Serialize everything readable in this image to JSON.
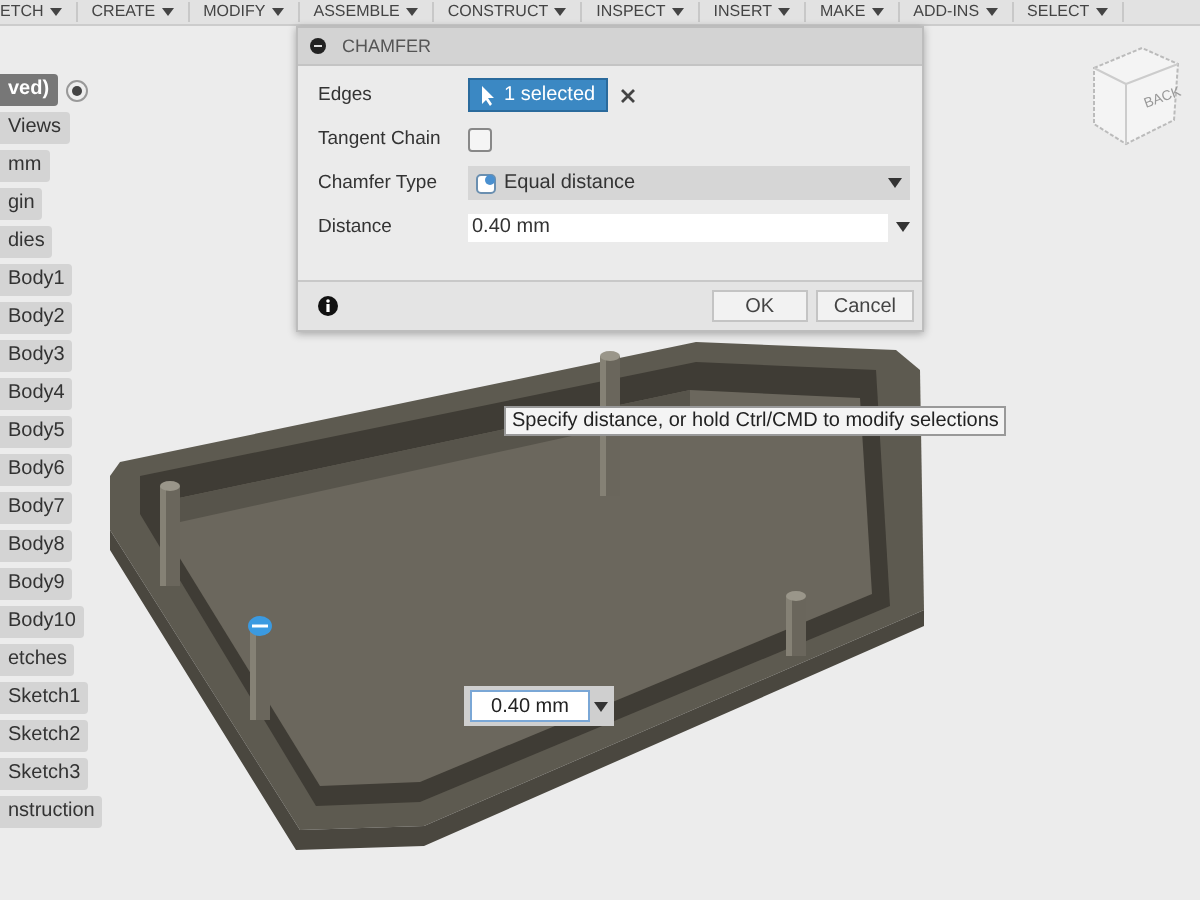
{
  "menu": [
    {
      "label": "ETCH"
    },
    {
      "label": "CREATE"
    },
    {
      "label": "MODIFY"
    },
    {
      "label": "ASSEMBLE"
    },
    {
      "label": "CONSTRUCT"
    },
    {
      "label": "INSPECT"
    },
    {
      "label": "INSERT"
    },
    {
      "label": "MAKE"
    },
    {
      "label": "ADD-INS"
    },
    {
      "label": "SELECT"
    }
  ],
  "browser": {
    "items": [
      {
        "label": "ved)",
        "selected": true,
        "kind": "root"
      },
      {
        "label": "Views",
        "selected": false,
        "kind": "item"
      },
      {
        "label": "mm",
        "selected": false,
        "kind": "item"
      },
      {
        "label": "gin",
        "selected": false,
        "kind": "item"
      },
      {
        "label": "dies",
        "selected": false,
        "kind": "item"
      },
      {
        "label": "Body1",
        "selected": false,
        "kind": "item"
      },
      {
        "label": "Body2",
        "selected": false,
        "kind": "item"
      },
      {
        "label": "Body3",
        "selected": false,
        "kind": "item"
      },
      {
        "label": "Body4",
        "selected": false,
        "kind": "item"
      },
      {
        "label": "Body5",
        "selected": false,
        "kind": "item"
      },
      {
        "label": "Body6",
        "selected": false,
        "kind": "item"
      },
      {
        "label": "Body7",
        "selected": false,
        "kind": "item"
      },
      {
        "label": "Body8",
        "selected": false,
        "kind": "item"
      },
      {
        "label": "Body9",
        "selected": false,
        "kind": "item"
      },
      {
        "label": "Body10",
        "selected": false,
        "kind": "item"
      },
      {
        "label": "etches",
        "selected": false,
        "kind": "item"
      },
      {
        "label": "Sketch1",
        "selected": false,
        "kind": "item"
      },
      {
        "label": "Sketch2",
        "selected": false,
        "kind": "item"
      },
      {
        "label": "Sketch3",
        "selected": false,
        "kind": "item"
      },
      {
        "label": "nstruction",
        "selected": false,
        "kind": "item"
      }
    ]
  },
  "dialog": {
    "title": "CHAMFER",
    "rows": [
      {
        "kind": "selection",
        "label": "Edges",
        "value": "1 selected"
      },
      {
        "kind": "checkbox",
        "label": "Tangent Chain",
        "checked": false
      },
      {
        "kind": "dropdown",
        "label": "Chamfer Type",
        "value": "Equal distance"
      },
      {
        "kind": "input",
        "label": "Distance",
        "value": "0.40 mm"
      }
    ],
    "buttons": [
      "OK",
      "Cancel"
    ]
  },
  "tooltip": "Specify distance, or hold Ctrl/CMD to modify selections",
  "distance_input": {
    "value": "0.40 mm"
  },
  "viewcube": {
    "face": "BACK"
  }
}
